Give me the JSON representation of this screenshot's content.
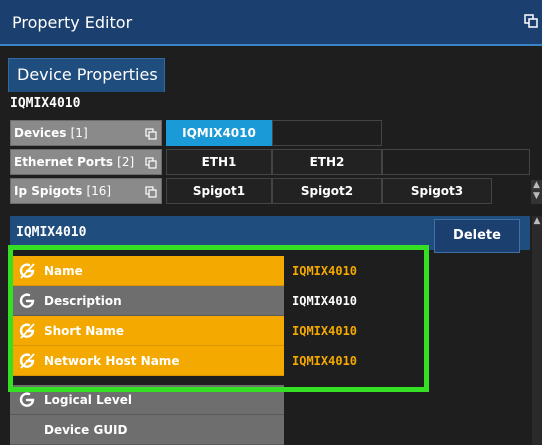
{
  "window": {
    "title": "Property Editor",
    "undock_icon": "undock-icon"
  },
  "tabs": [
    {
      "label": "Device Properties"
    }
  ],
  "device": {
    "name": "IQMIX4010"
  },
  "grid": {
    "devices": {
      "label": "Devices",
      "count": "[1]",
      "chips": [
        "IQMIX4010"
      ]
    },
    "ethernet": {
      "label": "Ethernet Ports",
      "count": "[2]",
      "chips": [
        "ETH1",
        "ETH2"
      ]
    },
    "spigots": {
      "label": "Ip Spigots",
      "count": "[16]",
      "chips": [
        "Spigot1",
        "Spigot2",
        "Spigot3"
      ]
    }
  },
  "section": {
    "name": "IQMIX4010",
    "delete_label": "Delete"
  },
  "properties": [
    {
      "label": "Name",
      "value": "IQMIX4010",
      "state": "overridden"
    },
    {
      "label": "Description",
      "value": "IQMIX4010",
      "state": "normal"
    },
    {
      "label": "Short Name",
      "value": "IQMIX4010",
      "state": "overridden"
    },
    {
      "label": "Network Host Name",
      "value": "IQMIX4010",
      "state": "overridden"
    },
    {
      "label": "Logical Level",
      "value": "",
      "state": "normal"
    },
    {
      "label": "Device GUID",
      "value": "",
      "state": "normal"
    }
  ],
  "colors": {
    "title_bar": "#1b3f6e",
    "selected_chip": "#1a9ad6",
    "override_orange": "#f4a900",
    "highlight_green": "#35e024"
  }
}
